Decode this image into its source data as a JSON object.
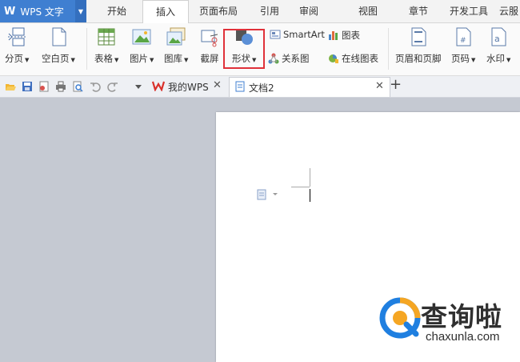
{
  "app": {
    "logo": "W",
    "title": "WPS 文字"
  },
  "menu_tabs": [
    "开始",
    "插入",
    "页面布局",
    "引用",
    "审阅",
    "视图",
    "章节",
    "开发工具",
    "云服"
  ],
  "ribbon": {
    "page_break": "分页",
    "blank_page": "空白页",
    "table": "表格",
    "picture": "图片",
    "gallery": "图库",
    "screenshot": "截屏",
    "shapes": "形状",
    "smartart": "SmartArt",
    "chart": "图表",
    "relation_chart": "关系图",
    "online_chart": "在线图表",
    "header_footer": "页眉和页脚",
    "page_number": "页码",
    "watermark": "水印"
  },
  "doc_tabs": [
    {
      "label": "我的WPS"
    },
    {
      "label": "文档2"
    }
  ],
  "new_tab_symbol": "+",
  "watermark_overlay": {
    "text": "查询啦",
    "site": "chaxunla.com"
  },
  "colors": {
    "accent": "#3f7fd1",
    "highlight": "#e0313a",
    "watermark_orange": "#f5a623",
    "watermark_blue": "#1f7fe0"
  }
}
